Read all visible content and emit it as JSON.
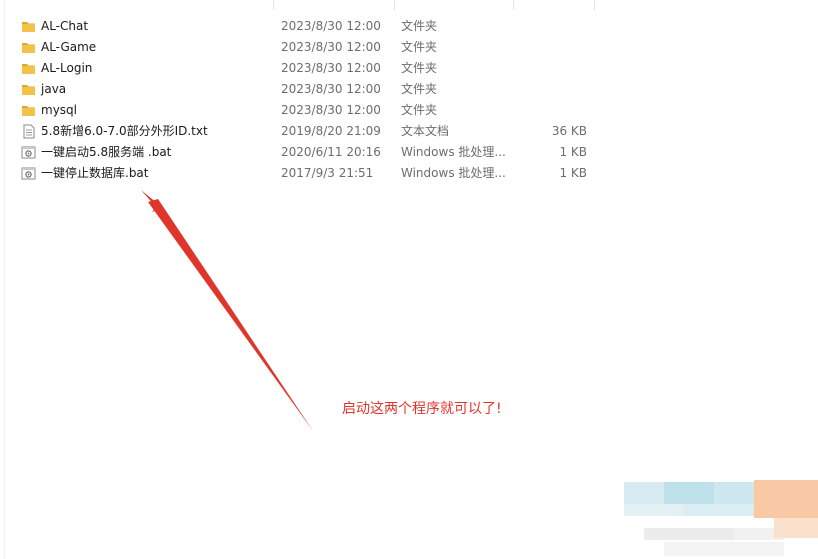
{
  "files": [
    {
      "name": "AL-Chat",
      "date": "2023/8/30 12:00",
      "type": "文件夹",
      "size": "",
      "icon": "folder-icon"
    },
    {
      "name": "AL-Game",
      "date": "2023/8/30 12:00",
      "type": "文件夹",
      "size": "",
      "icon": "folder-icon"
    },
    {
      "name": "AL-Login",
      "date": "2023/8/30 12:00",
      "type": "文件夹",
      "size": "",
      "icon": "folder-icon"
    },
    {
      "name": "java",
      "date": "2023/8/30 12:00",
      "type": "文件夹",
      "size": "",
      "icon": "folder-icon"
    },
    {
      "name": "mysql",
      "date": "2023/8/30 12:00",
      "type": "文件夹",
      "size": "",
      "icon": "folder-icon"
    },
    {
      "name": "5.8新增6.0-7.0部分外形ID.txt",
      "date": "2019/8/20 21:09",
      "type": "文本文档",
      "size": "36 KB",
      "icon": "text-file-icon"
    },
    {
      "name": "一键启动5.8服务端 .bat",
      "date": "2020/6/11 20:16",
      "type": "Windows 批处理...",
      "size": "1 KB",
      "icon": "batch-file-icon"
    },
    {
      "name": "一键停止数据库.bat",
      "date": "2017/9/3 21:51",
      "type": "Windows 批处理...",
      "size": "1 KB",
      "icon": "batch-file-icon"
    }
  ],
  "annotation": {
    "text": "启动这两个程序就可以了!",
    "color": "#e0352b"
  },
  "colors": {
    "folder": "#f3c24a",
    "folder_dark": "#e0a92c",
    "meta_text": "#6d6d6d"
  }
}
